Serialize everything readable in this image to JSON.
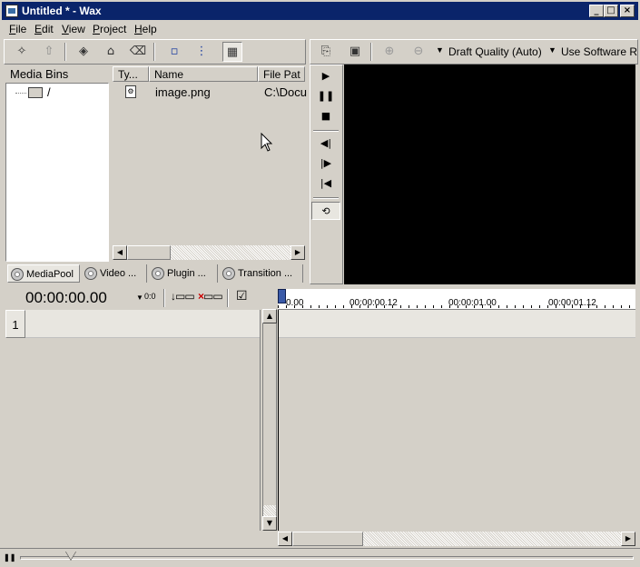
{
  "window": {
    "title": "Untitled * - Wax"
  },
  "window_controls": {
    "minimize": "_",
    "maximize": "□",
    "close": "×"
  },
  "menu": [
    {
      "accel": "F",
      "rest": "ile"
    },
    {
      "accel": "E",
      "rest": "dit"
    },
    {
      "accel": "V",
      "rest": "iew"
    },
    {
      "accel": "P",
      "rest": "roject"
    },
    {
      "accel": "H",
      "rest": "elp"
    }
  ],
  "media_toolbar": {
    "icons": [
      "new-bin-icon",
      "up-folder-icon",
      "layers-icon",
      "open-folder-icon",
      "delete-icon",
      "small-icons-icon",
      "tree-icon",
      "details-view-icon"
    ]
  },
  "preview_toolbar": {
    "quality": "Draft Quality (Auto)",
    "renderer": "Use Software Re"
  },
  "media_bins": {
    "header": "Media Bins",
    "root": "/"
  },
  "file_list": {
    "columns": [
      "Ty...",
      "Name",
      "File Pat"
    ],
    "rows": [
      {
        "type_icon": "image-file-icon",
        "name": "image.png",
        "path": "C:\\Docu"
      }
    ]
  },
  "tabs": [
    {
      "label": "MediaPool"
    },
    {
      "label": "Video ..."
    },
    {
      "label": "Plugin ..."
    },
    {
      "label": "Transition ..."
    }
  ],
  "player_controls": [
    "play",
    "pause",
    "stop",
    "prev-frame",
    "next-frame",
    "go-start",
    "loop"
  ],
  "timeline": {
    "timecode": "00:00:00.00",
    "zoom": "0:0",
    "track_number": "1",
    "ruler": [
      "0.00",
      "00:00:00.12",
      "00:00:01.00",
      "00:00:01.12"
    ]
  },
  "colors": {
    "titlebar": "#0a246a",
    "face": "#d4d0c8",
    "preview": "#000000"
  }
}
